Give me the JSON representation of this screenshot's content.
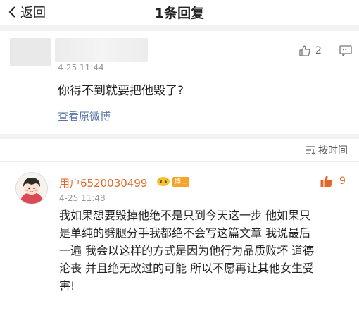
{
  "header": {
    "back_label": "返回",
    "title": "1条回复"
  },
  "original_comment": {
    "likes": "2",
    "time": "4-25 11:44",
    "text": "你得不到就要把他毁了?",
    "view_original": "查看原微博"
  },
  "sort": {
    "label": "按时间"
  },
  "reply": {
    "username": "用户6520030499",
    "badge": "博士",
    "likes": "9",
    "time": "4-25 11:48",
    "lines": [
      "我如果想要毁掉他绝不是只到今天这一步 他如果只",
      "是单纯的劈腿分手我都绝不会写这篇文章 我说最后",
      "一遍 我会以这样的方式是因为他行为品质败坏 道德",
      "沦丧 并且绝无改过的可能 所以不愿再让其他女生受",
      "害!"
    ]
  },
  "colors": {
    "link": "#5576a6",
    "username": "#e06a2a",
    "liked": "#e06a2a",
    "separator": "#f2f2f2"
  }
}
